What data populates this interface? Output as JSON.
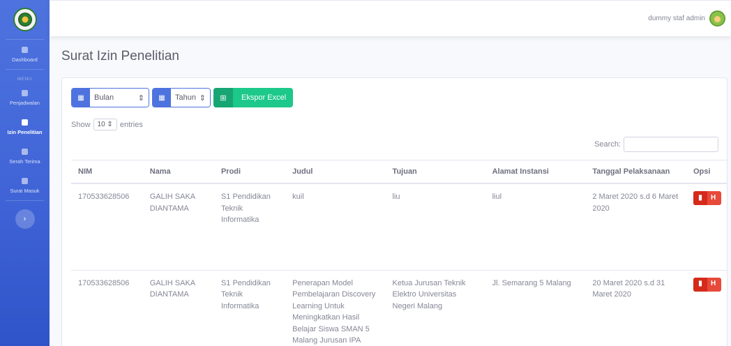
{
  "sidebar": {
    "logo_icon": "university-logo-icon",
    "dashboard": "Dashboard",
    "menu_heading": "MENU",
    "items": [
      {
        "label": "Penjadwalan",
        "icon": "calendar-icon"
      },
      {
        "label": "Izin Penelitian",
        "icon": "file-icon",
        "active": true
      },
      {
        "label": "Serah Terima",
        "icon": "document-icon"
      },
      {
        "label": "Surat Masuk",
        "icon": "inbox-icon"
      }
    ],
    "toggle": "›"
  },
  "topbar": {
    "user_name": "dummy staf admin"
  },
  "page": {
    "title": "Surat Izin Penelitian"
  },
  "filters": {
    "bulan": "Bulan",
    "tahun": "Tahun",
    "export_label": "Ekspor Excel"
  },
  "table_controls": {
    "show": "Show",
    "entries_value": "10",
    "entries": "entries",
    "search_label": "Search:"
  },
  "table": {
    "columns": [
      "NIM",
      "Nama",
      "Prodi",
      "Judul",
      "Tujuan",
      "Alamat Instansi",
      "Tanggal Pelaksanaan",
      "Opsi"
    ],
    "rows": [
      {
        "nim": "170533628506",
        "nama": "GALIH SAKA DIANTAMA",
        "prodi": "S1 Pendidikan Teknik Informatika",
        "judul": "kuil",
        "tujuan": "liu",
        "alamat": "liul",
        "tanggal": "2 Maret 2020 s.d 6 Maret 2020",
        "action": "H"
      },
      {
        "nim": "170533628506",
        "nama": "GALIH SAKA DIANTAMA",
        "prodi": "S1 Pendidikan Teknik Informatika",
        "judul": "Penerapan Model Pembelajaran Discovery Learning Untuk Meningkatkan Hasil Belajar Siswa SMAN 5 Malang Jurusan IPA",
        "tujuan": "Ketua Jurusan Teknik Elektro Universitas Negeri Malang",
        "alamat": "Jl. Semarang 5 Malang",
        "tanggal": "20 Maret 2020 s.d 31 Maret 2020",
        "action": "H"
      }
    ]
  },
  "colors": {
    "primary": "#4e73df",
    "success": "#1cc88a",
    "danger": "#e74a3b"
  }
}
